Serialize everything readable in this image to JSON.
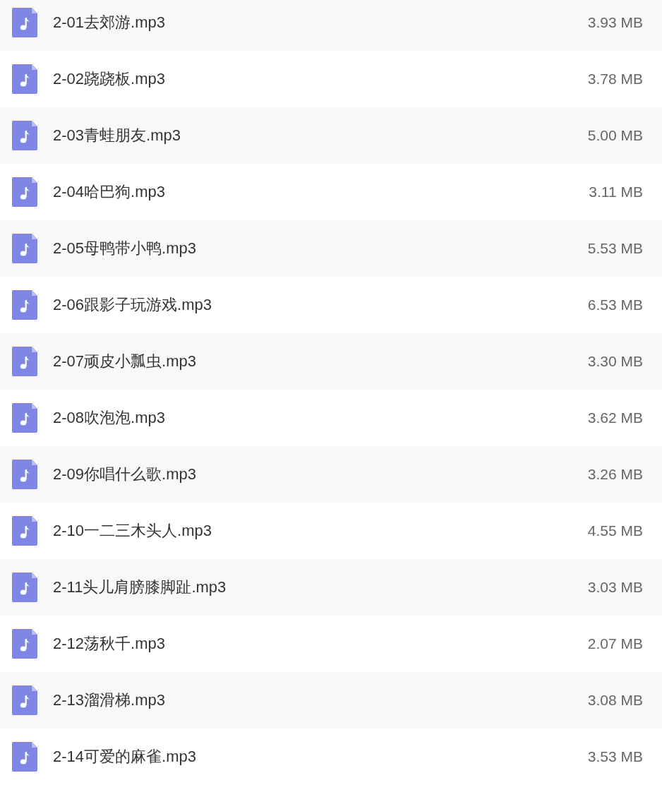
{
  "files": [
    {
      "name": "2-01去郊游.mp3",
      "size": "3.93 MB"
    },
    {
      "name": "2-02跷跷板.mp3",
      "size": "3.78 MB"
    },
    {
      "name": "2-03青蛙朋友.mp3",
      "size": "5.00 MB"
    },
    {
      "name": "2-04哈巴狗.mp3",
      "size": "3.11 MB"
    },
    {
      "name": "2-05母鸭带小鸭.mp3",
      "size": "5.53 MB"
    },
    {
      "name": "2-06跟影子玩游戏.mp3",
      "size": "6.53 MB"
    },
    {
      "name": "2-07顽皮小瓢虫.mp3",
      "size": "3.30 MB"
    },
    {
      "name": "2-08吹泡泡.mp3",
      "size": "3.62 MB"
    },
    {
      "name": "2-09你唱什么歌.mp3",
      "size": "3.26 MB"
    },
    {
      "name": "2-10一二三木头人.mp3",
      "size": "4.55 MB"
    },
    {
      "name": "2-11头儿肩膀膝脚趾.mp3",
      "size": "3.03 MB"
    },
    {
      "name": "2-12荡秋千.mp3",
      "size": "2.07 MB"
    },
    {
      "name": "2-13溜滑梯.mp3",
      "size": "3.08 MB"
    },
    {
      "name": "2-14可爱的麻雀.mp3",
      "size": "3.53 MB"
    }
  ]
}
